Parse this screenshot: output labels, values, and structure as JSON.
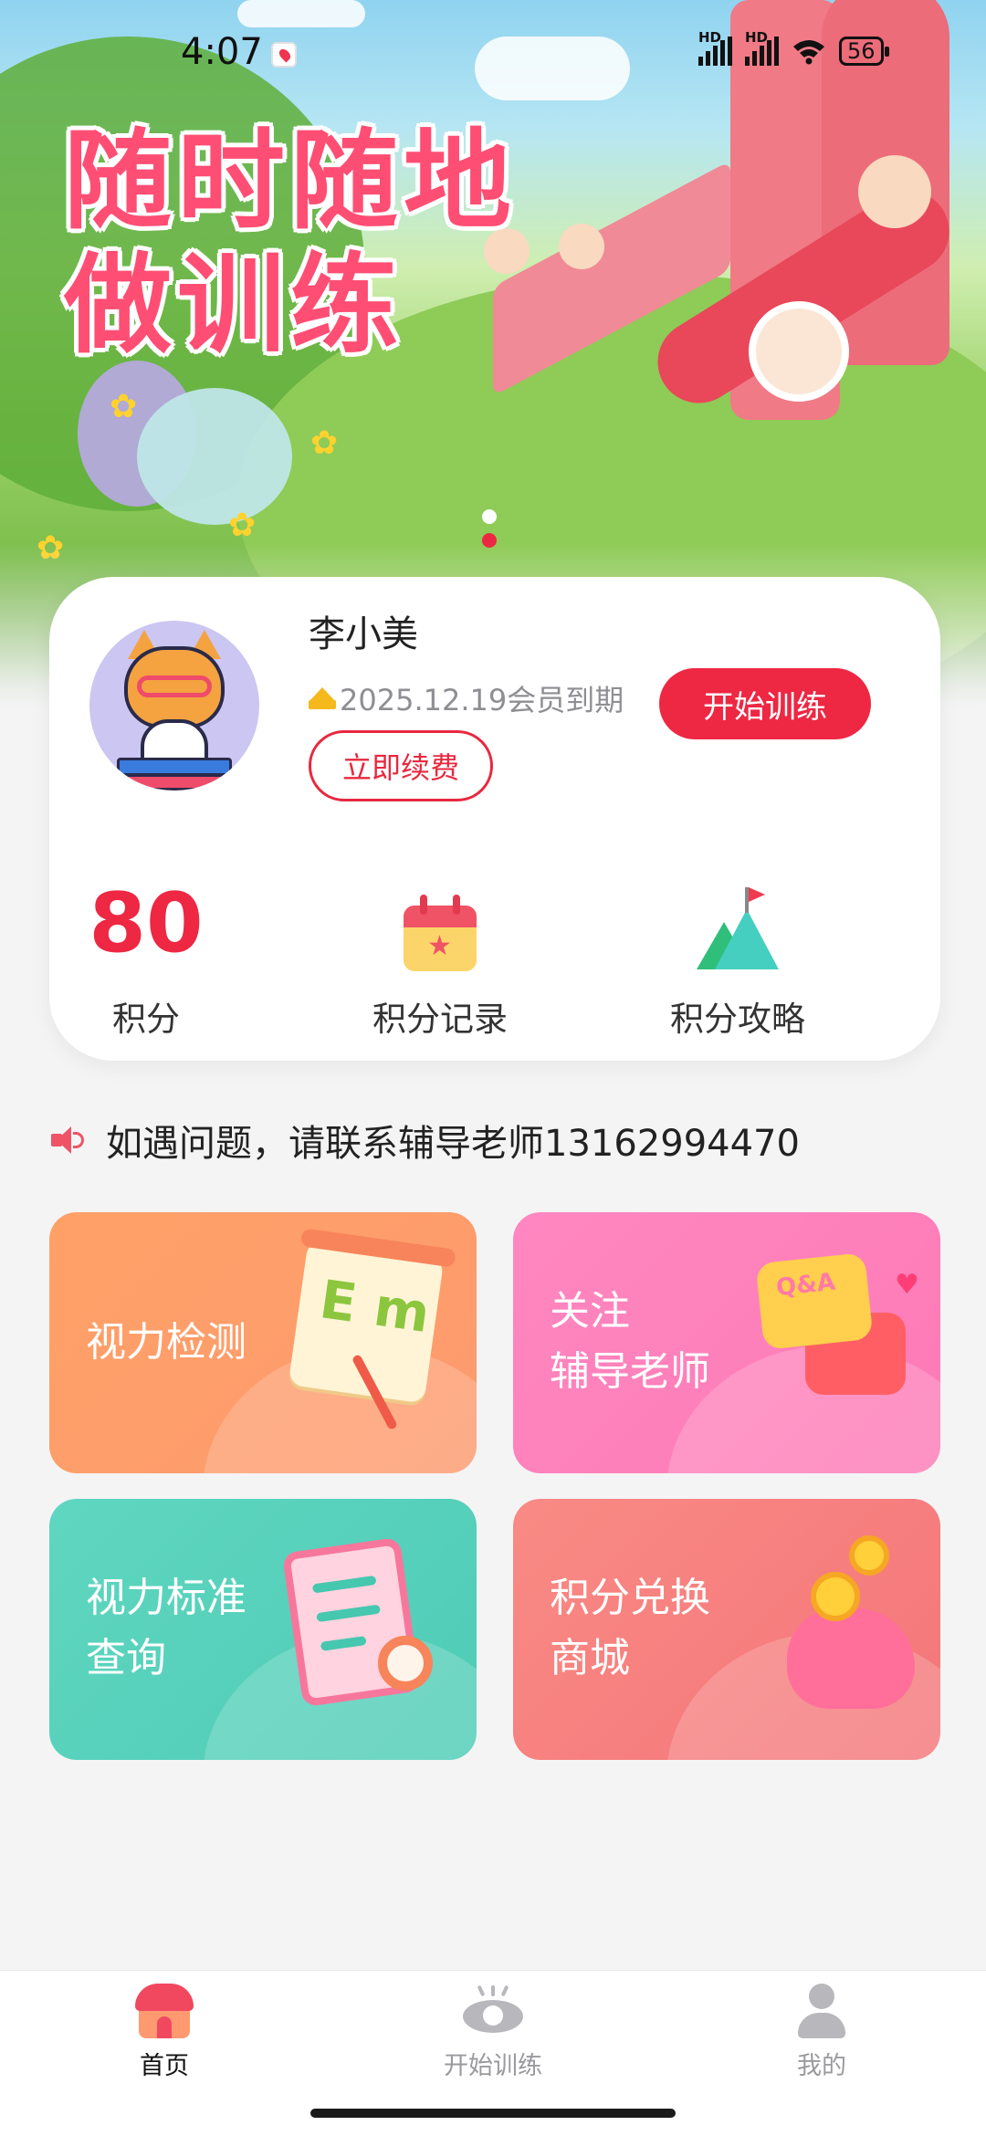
{
  "status_bar": {
    "time": "4:07",
    "network_1": "HD",
    "network_2": "HD",
    "battery": "56"
  },
  "banner": {
    "title_line1": "随时随地",
    "title_line2": "做训练",
    "slide_count": 2,
    "active_slide": 2
  },
  "profile": {
    "name": "李小美",
    "membership_expiry": "2025.12.19会员到期",
    "renew_label": "立即续费",
    "start_training_label": "开始训练"
  },
  "stats": {
    "points_value": "80",
    "points_label": "积分",
    "records_label": "积分记录",
    "guide_label": "积分攻略"
  },
  "notice": {
    "text": "如遇问题，请联系辅导老师13162994470"
  },
  "tiles": [
    {
      "label": "视力检测",
      "color": "#ffa167"
    },
    {
      "label": "关注\n辅导老师",
      "color": "#ff87c0"
    },
    {
      "label": "视力标准\n查询",
      "color": "#5fd6c0"
    },
    {
      "label": "积分兑换\n商城",
      "color": "#f98a84"
    }
  ],
  "nav": {
    "items": [
      {
        "label": "首页",
        "icon": "home-icon",
        "active": true
      },
      {
        "label": "开始训练",
        "icon": "eye-icon",
        "active": false
      },
      {
        "label": "我的",
        "icon": "user-icon",
        "active": false
      }
    ]
  },
  "colors": {
    "accent": "#ee2743",
    "inactive": "#9a9a9e"
  }
}
